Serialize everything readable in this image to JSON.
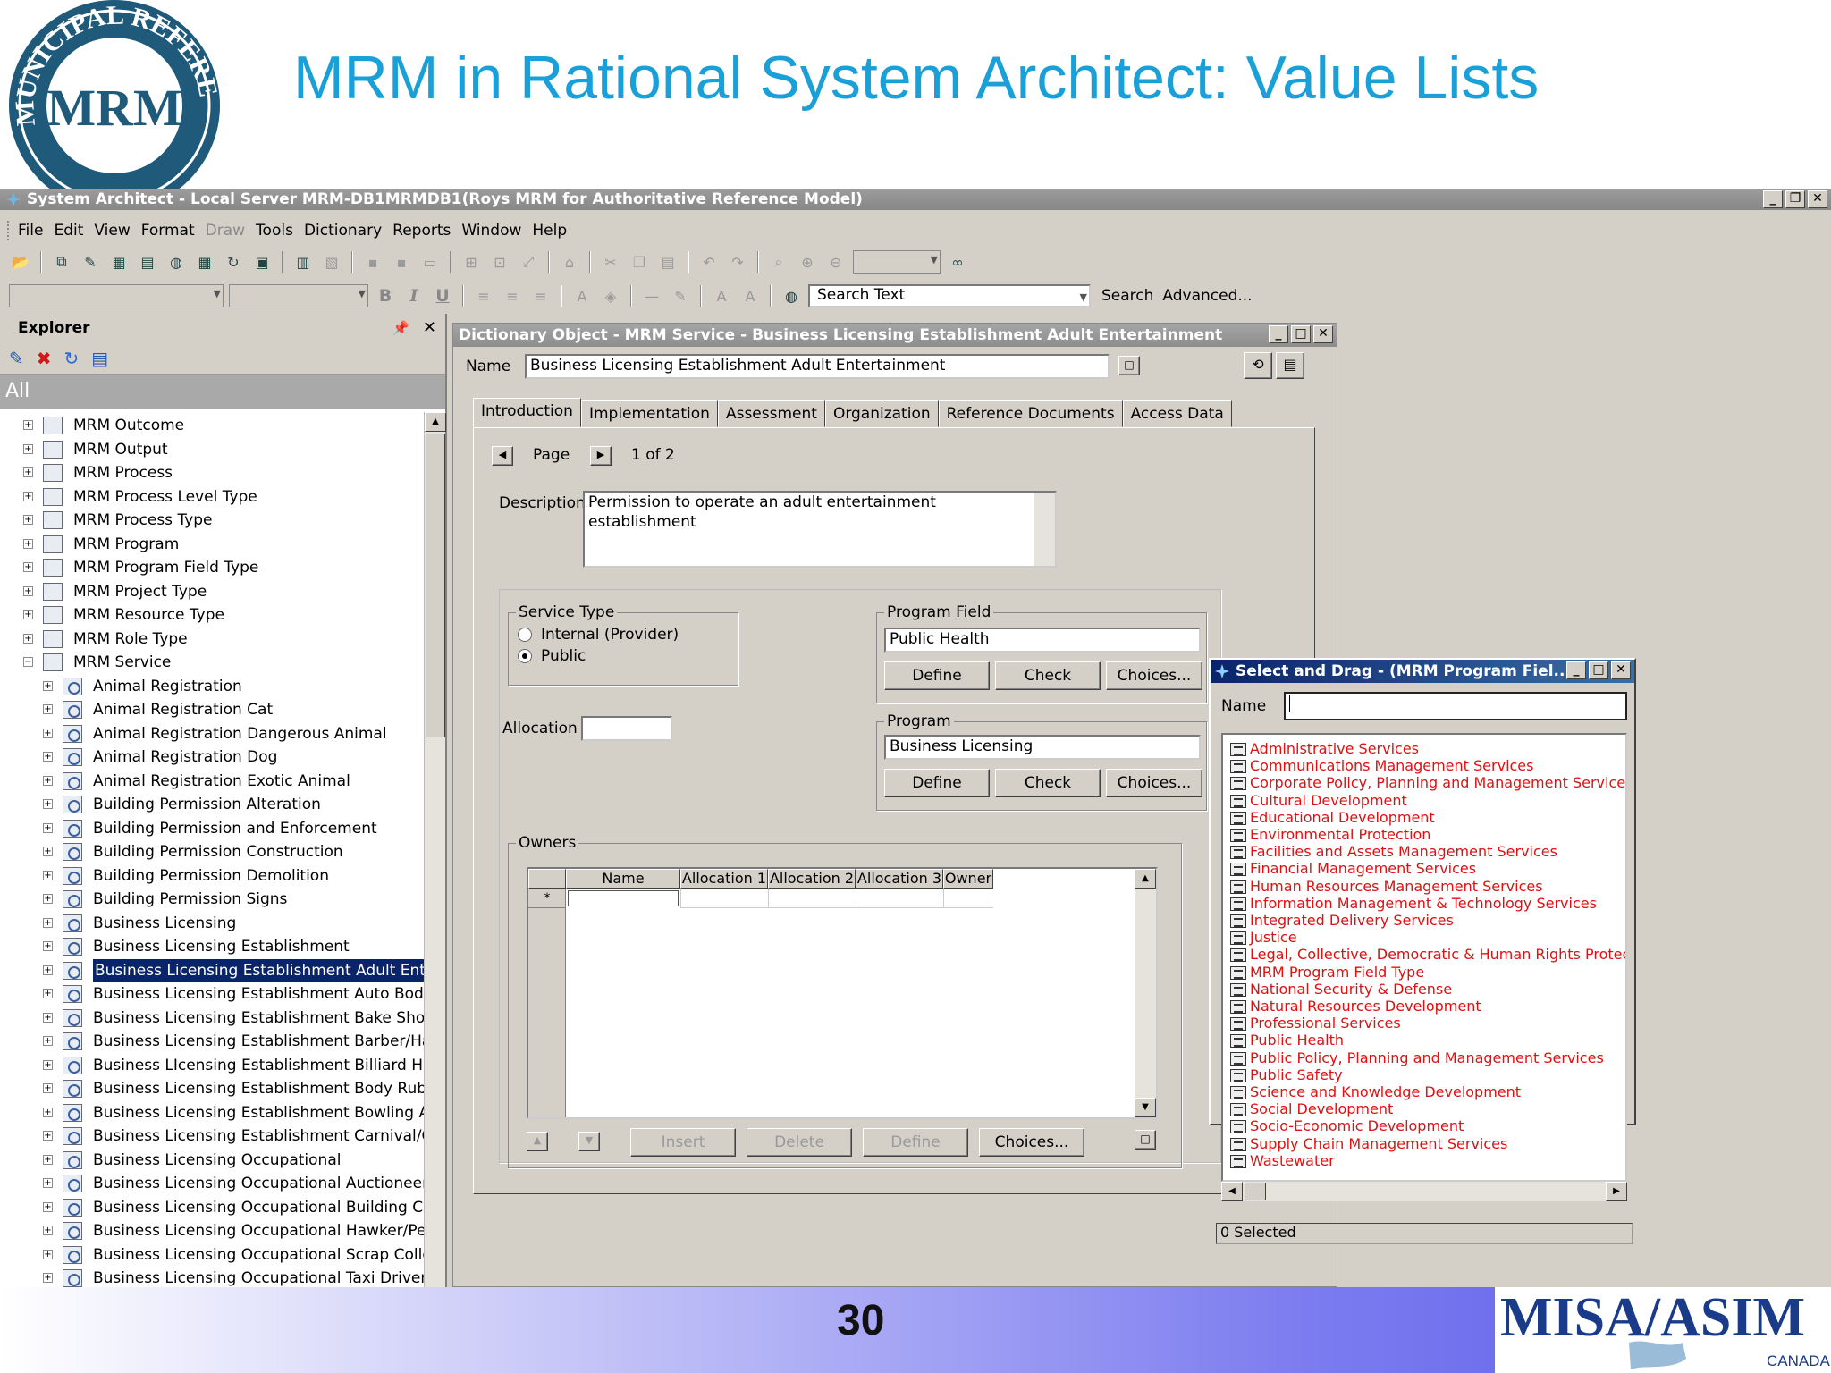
{
  "slide": {
    "title": "MRM in Rational System Architect: Value Lists",
    "page_number": "30"
  },
  "logos": {
    "seal_text": "MUNICIPAL REFERENCE MODEL PROGRAM",
    "seal_center": "MRM",
    "footer_brand": "MISA/ASIM",
    "footer_sub": "CANADA"
  },
  "app": {
    "title": "System Architect - Local Server MRM-DB1MRMDB1(Roys MRM for Authoritative Reference Model)",
    "menu": [
      "File",
      "Edit",
      "View",
      "Format",
      "Draw",
      "Tools",
      "Dictionary",
      "Reports",
      "Window",
      "Help"
    ],
    "search": {
      "value": "Search Text",
      "button": "Search",
      "advanced": "Advanced..."
    }
  },
  "explorer": {
    "title": "Explorer",
    "scope": "All",
    "top_items": [
      "MRM Outcome",
      "MRM Output",
      "MRM Process",
      "MRM Process Level Type",
      "MRM Process Type",
      "MRM Program",
      "MRM Program Field Type",
      "MRM Project Type",
      "MRM Resource Type",
      "MRM Role Type",
      "MRM Service"
    ],
    "service_items": [
      "Animal Registration",
      "Animal Registration Cat",
      "Animal Registration Dangerous Animal",
      "Animal Registration Dog",
      "Animal Registration Exotic Animal",
      "Building Permission Alteration",
      "Building Permission and Enforcement",
      "Building Permission Construction",
      "Building Permission Demolition",
      "Building Permission Signs",
      "Business Licensing",
      "Business Licensing Establishment",
      "Business Licensing Establishment Adult Entertain",
      "Business Licensing Establishment Auto Body Rep",
      "Business Licensing Establishment Bake Shop",
      "Business Licensing Establishment Barber/Hair Dr",
      "Business LIcensing Establishment Billiard Hall",
      "Business Licensing Establishment Body Rub Parl",
      "Business Licensing Establishment Bowling Alley",
      "Business Licensing Establishment Carnival/Circu",
      "Business Licensing Occupational",
      "Business Licensing Occupational Auctioneer",
      "Business Licensing Occupational Building Contra",
      "Business Licensing Occupational Hawker/Peddl",
      "Business Licensing Occupational Scrap Collecto",
      "Business Licensing Occupational Taxi Driver"
    ],
    "selected_index": 12
  },
  "dictionary": {
    "title": "Dictionary Object - MRM Service - Business Licensing Establishment Adult Entertainment",
    "name_label": "Name",
    "name_value": "Business Licensing Establishment Adult Entertainment",
    "tabs": [
      "Introduction",
      "Implementation",
      "Assessment",
      "Organization",
      "Reference Documents",
      "Access Data"
    ],
    "page_label": "Page",
    "page_value": "1 of 2",
    "description_label": "Description",
    "description_value": "Permission to operate an adult entertainment establishment",
    "service_type": {
      "label": "Service Type",
      "options": [
        "Internal (Provider)",
        "Public"
      ],
      "selected": "Public"
    },
    "allocation_label": "Allocation",
    "program_field": {
      "label": "Program Field",
      "value": "Public Health"
    },
    "program": {
      "label": "Program",
      "value": "Business Licensing"
    },
    "buttons": {
      "define": "Define",
      "check": "Check",
      "choices": "Choices..."
    },
    "owners": {
      "label": "Owners",
      "columns": [
        "Name",
        "Allocation 1",
        "Allocation 2",
        "Allocation 3",
        "Owner"
      ],
      "new_row_marker": "*",
      "buttons": [
        "Insert",
        "Delete",
        "Define",
        "Choices..."
      ]
    }
  },
  "select_drag": {
    "title": "Select and Drag - (MRM Program Fiel...",
    "name_label": "Name",
    "items": [
      "Administrative Services",
      "Communications Management Services",
      "Corporate Policy, Planning and Management Services",
      "Cultural Development",
      "Educational Development",
      "Environmental Protection",
      "Facilities and Assets Management Services",
      "Financial Management Services",
      "Human Resources Management Services",
      "Information Management & Technology Services",
      "Integrated Delivery Services",
      "Justice",
      "Legal, Collective, Democratic & Human Rights Protect",
      "MRM Program Field Type",
      "National Security & Defense",
      "Natural Resources Development",
      "Professional Services",
      "Public Health",
      "Public Policy, Planning and Management Services",
      "Public Safety",
      "Science and Knowledge Development",
      "Social Development",
      "Socio-Economic Development",
      "Supply Chain Management Services",
      "Wastewater"
    ],
    "status": "0 Selected"
  },
  "colors": {
    "title_blue": "#1aa0d8",
    "list_red": "#e01010",
    "selection": "#0a246a"
  }
}
